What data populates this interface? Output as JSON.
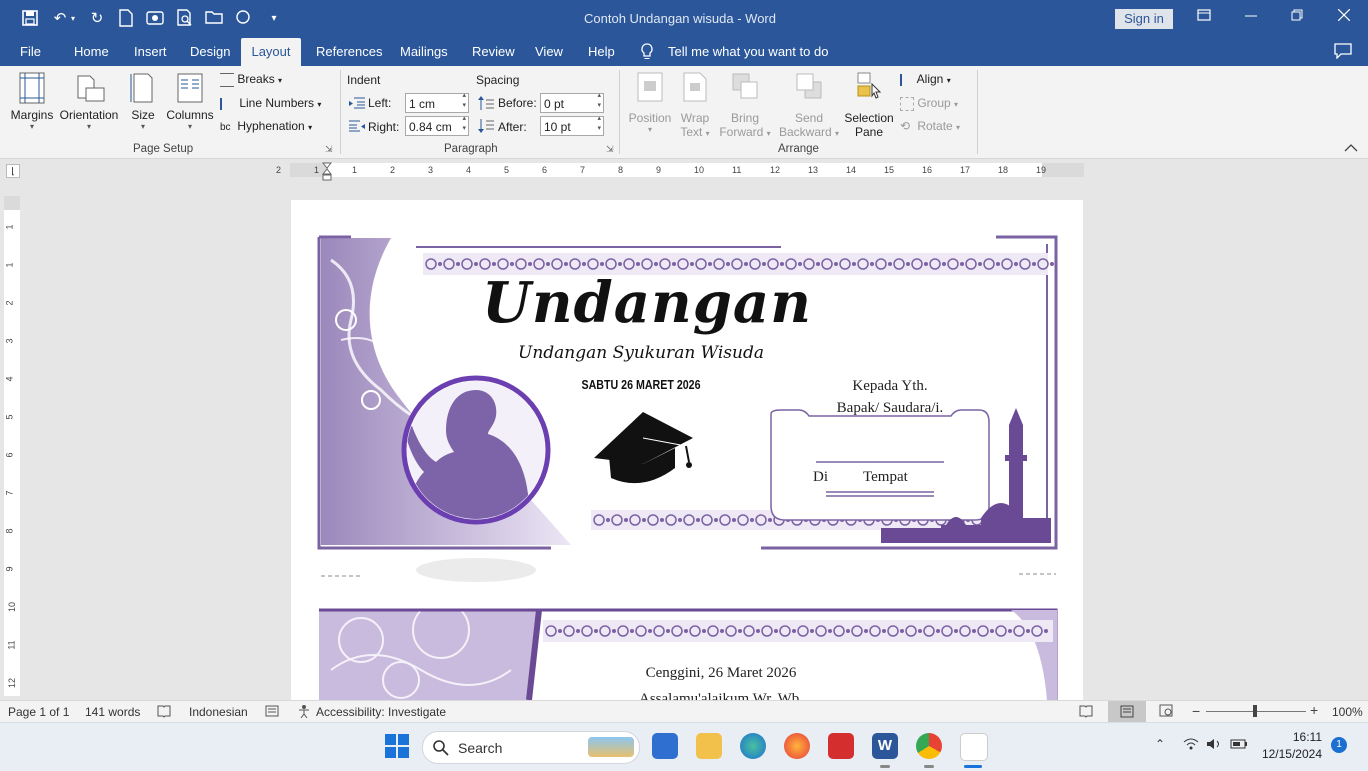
{
  "window": {
    "title": "Contoh Undangan wisuda  -  Word",
    "sign_in": "Sign in"
  },
  "qat": {
    "icons": [
      "save-icon",
      "undo-icon",
      "redo-icon",
      "new-icon",
      "share-icon",
      "print-preview-icon",
      "open-icon",
      "circle-icon",
      "customize-icon"
    ]
  },
  "tabs": [
    "File",
    "Home",
    "Insert",
    "Design",
    "Layout",
    "References",
    "Mailings",
    "Review",
    "View",
    "Help"
  ],
  "active_tab": "Layout",
  "tell_me": "Tell me what you want to do",
  "ribbon": {
    "page_setup": {
      "margins": "Margins",
      "orientation": "Orientation",
      "size": "Size",
      "columns": "Columns",
      "breaks": "Breaks",
      "line_numbers": "Line Numbers",
      "hyphenation": "Hyphenation",
      "label": "Page Setup"
    },
    "paragraph": {
      "indent": "Indent",
      "spacing": "Spacing",
      "left_label": "Left:",
      "left_value": "1 cm",
      "right_label": "Right:",
      "right_value": "0.84 cm",
      "before_label": "Before:",
      "before_value": "0 pt",
      "after_label": "After:",
      "after_value": "10 pt",
      "label": "Paragraph"
    },
    "arrange": {
      "position": "Position",
      "wrap_text_1": "Wrap",
      "wrap_text_2": "Text",
      "bring_forward_1": "Bring",
      "bring_forward_2": "Forward",
      "send_backward_1": "Send",
      "send_backward_2": "Backward",
      "selection_pane_1": "Selection",
      "selection_pane_2": "Pane",
      "align": "Align",
      "group": "Group",
      "rotate": "Rotate",
      "label": "Arrange"
    }
  },
  "ruler": {
    "h_numbers": [
      "2",
      "1",
      "1",
      "2",
      "3",
      "4",
      "5",
      "6",
      "7",
      "8",
      "9",
      "10",
      "11",
      "12",
      "13",
      "14",
      "15",
      "16",
      "17",
      "18",
      "19"
    ],
    "v_numbers": [
      "1",
      "1",
      "2",
      "3",
      "4",
      "5",
      "6",
      "7",
      "8",
      "9",
      "10",
      "11",
      "12"
    ]
  },
  "document": {
    "invite_title": "Undangan",
    "invite_subtitle": "Undangan  Syukuran Wisuda",
    "date_line": "SABTU 26 MARET 2026",
    "kepada": "Kepada Yth.",
    "bapak": "Bapak/ Saudara/i.",
    "di": "Di",
    "tempat": "Tempat",
    "page2_date": "Cenggini, 26 Maret 2026",
    "page2_partial": "Assalamu'alaikum Wr. Wb."
  },
  "status": {
    "page": "Page 1 of 1",
    "words": "141 words",
    "language": "Indonesian",
    "accessibility": "Accessibility: Investigate",
    "zoom": "100%"
  },
  "taskbar": {
    "search": "Search",
    "time": "16:11",
    "date": "12/15/2024",
    "notifications": "1"
  },
  "colors": {
    "word_blue": "#2b579a",
    "purple": "#6a4a94",
    "light_purple": "#b9a6d6"
  }
}
